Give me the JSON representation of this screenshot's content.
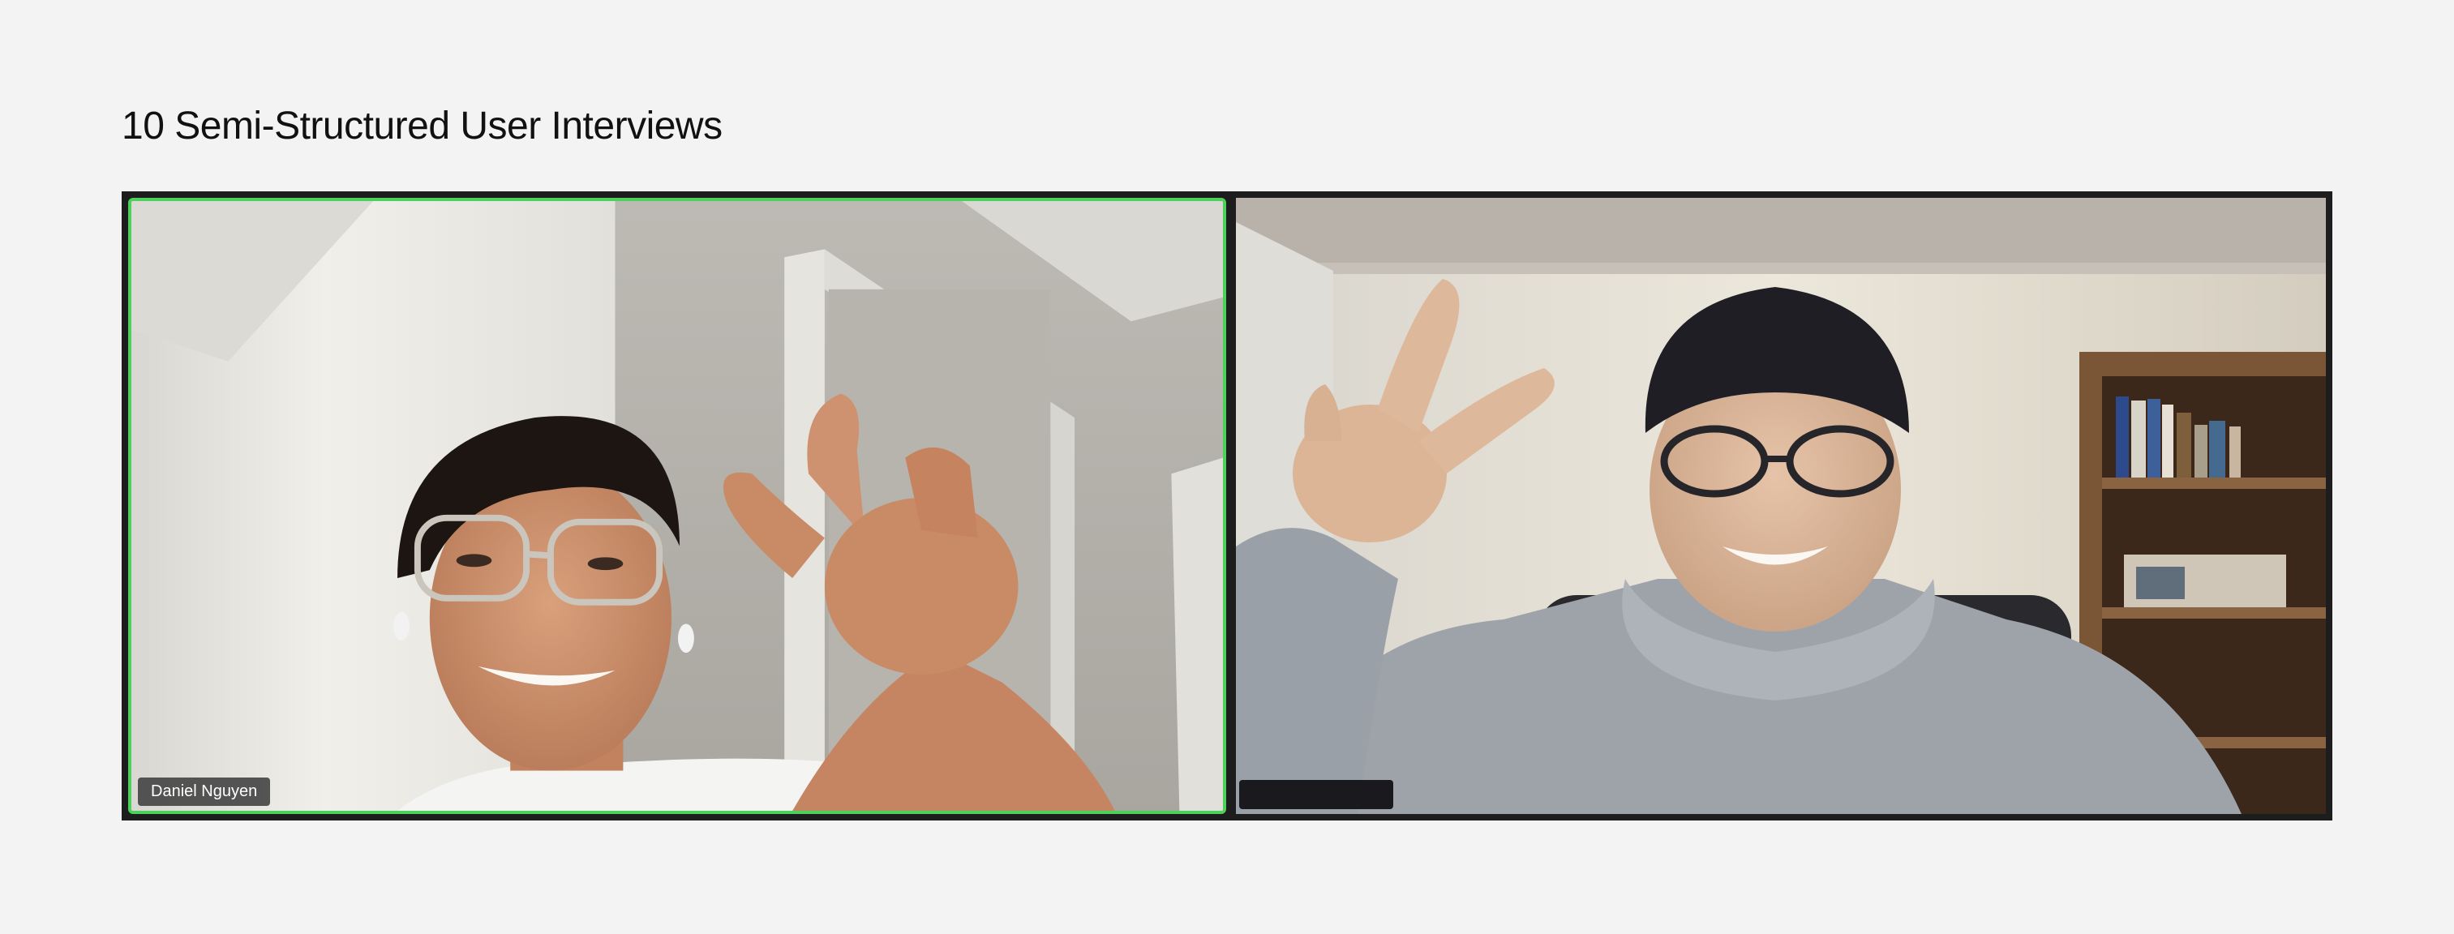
{
  "page": {
    "title": "10 Semi-Structured User Interviews"
  },
  "call": {
    "participants": [
      {
        "name": "Daniel Nguyen",
        "active_speaker": true
      },
      {
        "name": "",
        "active_speaker": false
      }
    ]
  },
  "colors": {
    "background": "#f3f3f3",
    "call_frame": "#1d1d1d",
    "active_speaker_border": "#4cd25a",
    "name_tag": "#464646"
  },
  "icons": []
}
